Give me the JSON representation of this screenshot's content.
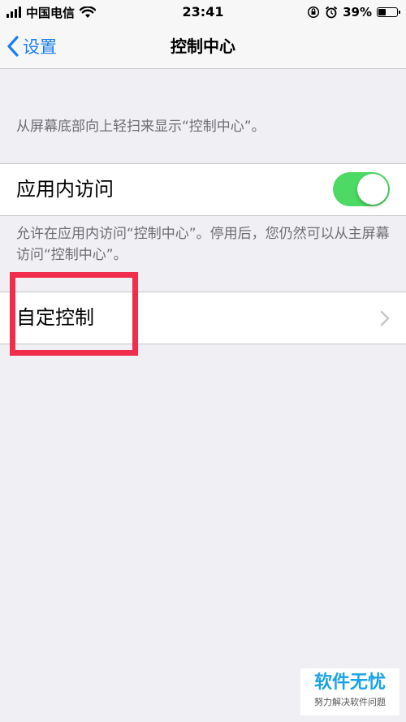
{
  "status_bar": {
    "carrier": "中国电信",
    "time": "23:41",
    "battery_percent": "39%",
    "battery_level": 0.39,
    "icons": [
      "signal-icon",
      "wifi-icon",
      "rotation-lock-icon",
      "alarm-icon",
      "battery-icon"
    ]
  },
  "nav": {
    "back_label": "设置",
    "title": "控制中心"
  },
  "content": {
    "intro_note": "从屏幕底部向上轻扫来显示“控制中心”。",
    "access_within_apps": {
      "label": "应用内访问",
      "enabled": true
    },
    "access_note": "允许在应用内访问“控制中心”。停用后，您仍然可以从主屏幕访问“控制中心”。",
    "customize": {
      "label": "自定控制"
    }
  },
  "colors": {
    "accent": "#1a7ef5",
    "toggle_on": "#4cd964",
    "highlight": "#f02d4c",
    "background": "#efeff4"
  },
  "watermark": {
    "title": "软件无忧",
    "subtitle": "努力解决软件问题"
  }
}
